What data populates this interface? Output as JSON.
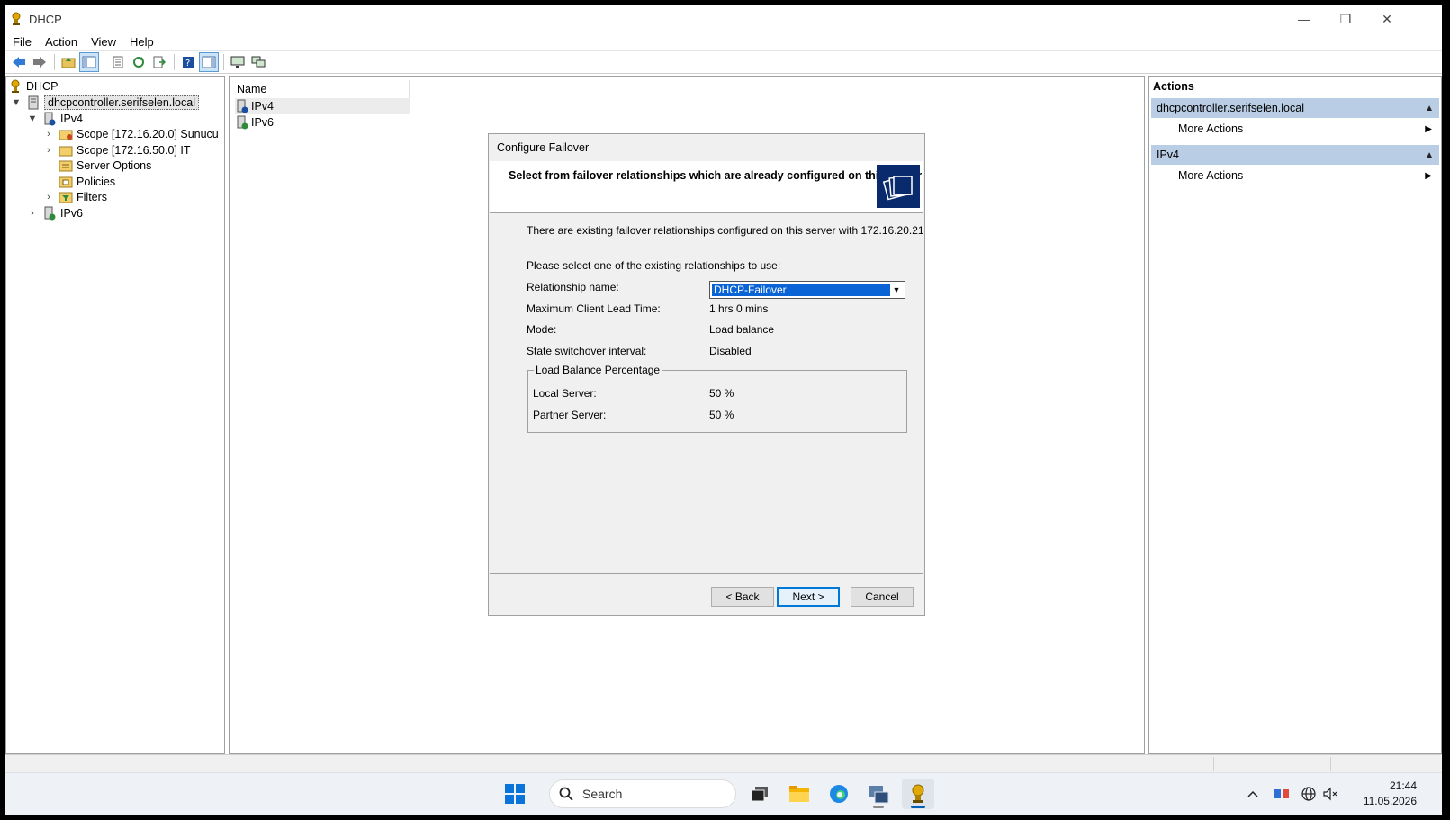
{
  "window": {
    "title": "DHCP",
    "controls": [
      "—",
      "❐",
      "✕"
    ]
  },
  "menu": [
    "File",
    "Action",
    "View",
    "Help"
  ],
  "tree": {
    "root": "DHCP",
    "server": "dhcpcontroller.serifselen.local",
    "ipv4": "IPv4",
    "scope1": "Scope [172.16.20.0] Sunucu",
    "scope2": "Scope [172.16.50.0] IT",
    "server_options": "Server Options",
    "policies": "Policies",
    "filters": "Filters",
    "ipv6": "IPv6"
  },
  "list": {
    "column_name": "Name",
    "items": [
      "IPv4",
      "IPv6"
    ]
  },
  "actions": {
    "title": "Actions",
    "group1": "dhcpcontroller.serifselen.local",
    "group1_item": "More Actions",
    "group2": "IPv4",
    "group2_item": "More Actions"
  },
  "dialog": {
    "title": "Configure Failover",
    "header": "Select from failover relationships which are already configured on this server",
    "intro": "There are existing failover relationships configured on this server with 172.16.20.21",
    "prompt": "Please select one of the existing relationships to use:",
    "rel_label": "Relationship name:",
    "rel_value": "DHCP-Failover",
    "lead_label": "Maximum Client Lead Time:",
    "lead_value": "1 hrs 0 mins",
    "mode_label": "Mode:",
    "mode_value": "Load balance",
    "switch_label": "State switchover interval:",
    "switch_value": "Disabled",
    "lb_group": "Load Balance Percentage",
    "local_label": "Local Server:",
    "local_value": "50 %",
    "partner_label": "Partner Server:",
    "partner_value": "50 %",
    "back": "< Back",
    "next": "Next >",
    "cancel": "Cancel"
  },
  "taskbar": {
    "search_placeholder": "Search",
    "time": "21:44",
    "date": "11.05.2026"
  },
  "colors": {
    "accent": "#0078d7",
    "selection": "#0a64d6",
    "action_group": "#b9cde5",
    "dialog_bg": "#f0f0f0"
  }
}
